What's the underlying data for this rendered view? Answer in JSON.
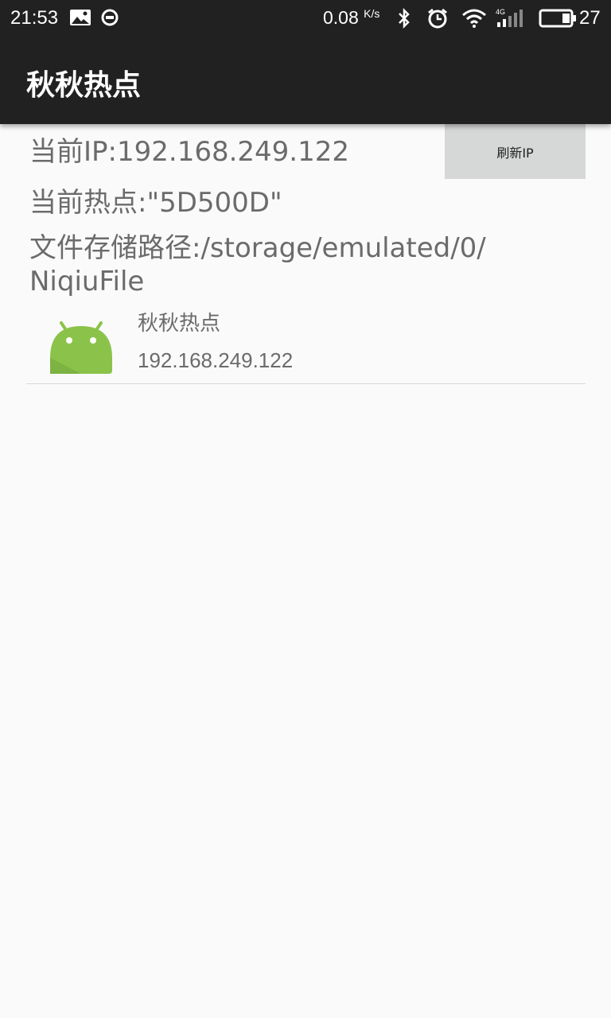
{
  "status_bar": {
    "time": "21:53",
    "net_speed": "0.08",
    "net_unit": "K/s",
    "battery": "27",
    "icons": [
      "image-notification-icon",
      "app-notification-icon",
      "bluetooth-icon",
      "alarm-icon",
      "wifi-icon",
      "cellular-4g-icon",
      "battery-icon"
    ]
  },
  "app_bar": {
    "title": "秋秋热点"
  },
  "info": {
    "current_ip": "当前IP:192.168.249.122",
    "current_hotspot": "当前热点:\"5D500D\"",
    "storage_path_line1": "文件存储路径:/storage/emulated/0/",
    "storage_path_line2": "NiqiuFile"
  },
  "refresh_button": {
    "label": "刷新IP"
  },
  "devices": [
    {
      "name": "秋秋热点",
      "ip": "192.168.249.122",
      "icon": "android-icon"
    }
  ],
  "colors": {
    "bar": "#212121",
    "background": "#fafafa",
    "button": "#d6d7d7",
    "text": "#6b6b6b",
    "android_green": "#8bc34a"
  }
}
